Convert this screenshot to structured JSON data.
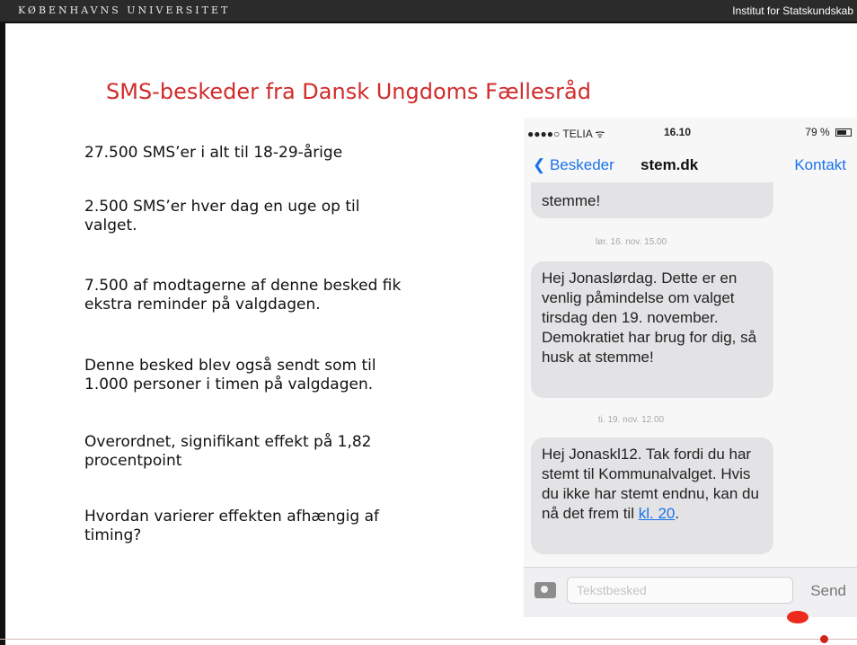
{
  "header": {
    "university": "KØBENHAVNS UNIVERSITET",
    "institute": "Institut for Statskundskab"
  },
  "slide": {
    "title": "SMS-beskeder fra Dansk Ungdoms Fællesråd",
    "bullets": [
      "27.500 SMS’er i alt til 18-29-årige",
      "2.500 SMS’er hver dag en uge op til\nvalget.",
      "7.500 af modtagerne af denne besked fik\nekstra reminder på valgdagen.",
      "Denne besked blev også sendt som til\n1.000 personer i timen på valgdagen.",
      "Overordnet, signifikant effekt på 1,82\nprocentpoint",
      "Hvordan varierer effekten afhængig af\ntiming?"
    ]
  },
  "phone": {
    "status": {
      "carrier": "●●●●○ TELIA ᯤ",
      "time": "16.10",
      "battery": "79 %"
    },
    "nav": {
      "back_label": "❮ Beskeder",
      "title": "stem.dk",
      "contact_label": "Kontakt"
    },
    "messages": {
      "partial": "stemme!",
      "timestamp1": "lør. 16. nov. 15.00",
      "m1": "Hej Jonaslørdag. Dette er en venlig påmindelse om valget tirsdag den 19. november. Demokratiet har brug for dig, så husk at stemme!",
      "timestamp2": "ti. 19. nov. 12.00",
      "m2_text": "Hej Jonaskl12. Tak fordi du har stemt til Kommunalvalget. Hvis du ikke har stemt endnu, kan du nå det frem til ",
      "m2_link": "kl. 20",
      "m2_end": "."
    },
    "input": {
      "placeholder": "Tekstbesked",
      "send_label": "Send"
    }
  },
  "colors": {
    "accent": "#d12b2b",
    "link": "#1a73e8",
    "dot": "#ee2a1c"
  }
}
